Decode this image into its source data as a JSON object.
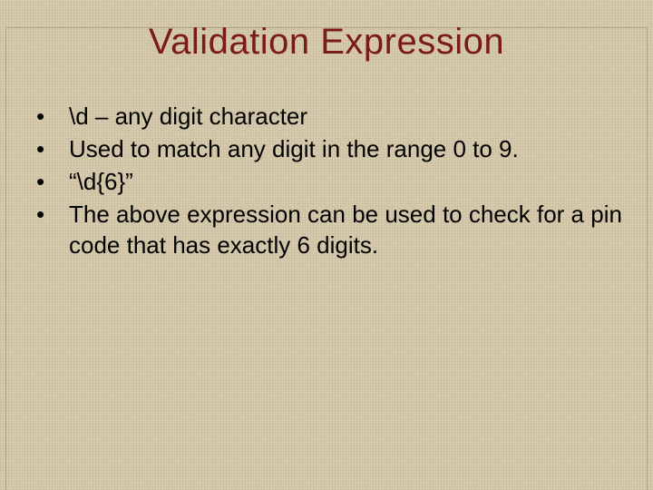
{
  "title": "Validation Expression",
  "bullets": [
    {
      "text": "\\d – any digit character"
    },
    {
      "text": "Used to match any digit in the range 0 to 9."
    },
    {
      "text": "“\\d{6}”"
    },
    {
      "text": "The above expression can be used to check for a pin code that has exactly 6 digits."
    }
  ]
}
